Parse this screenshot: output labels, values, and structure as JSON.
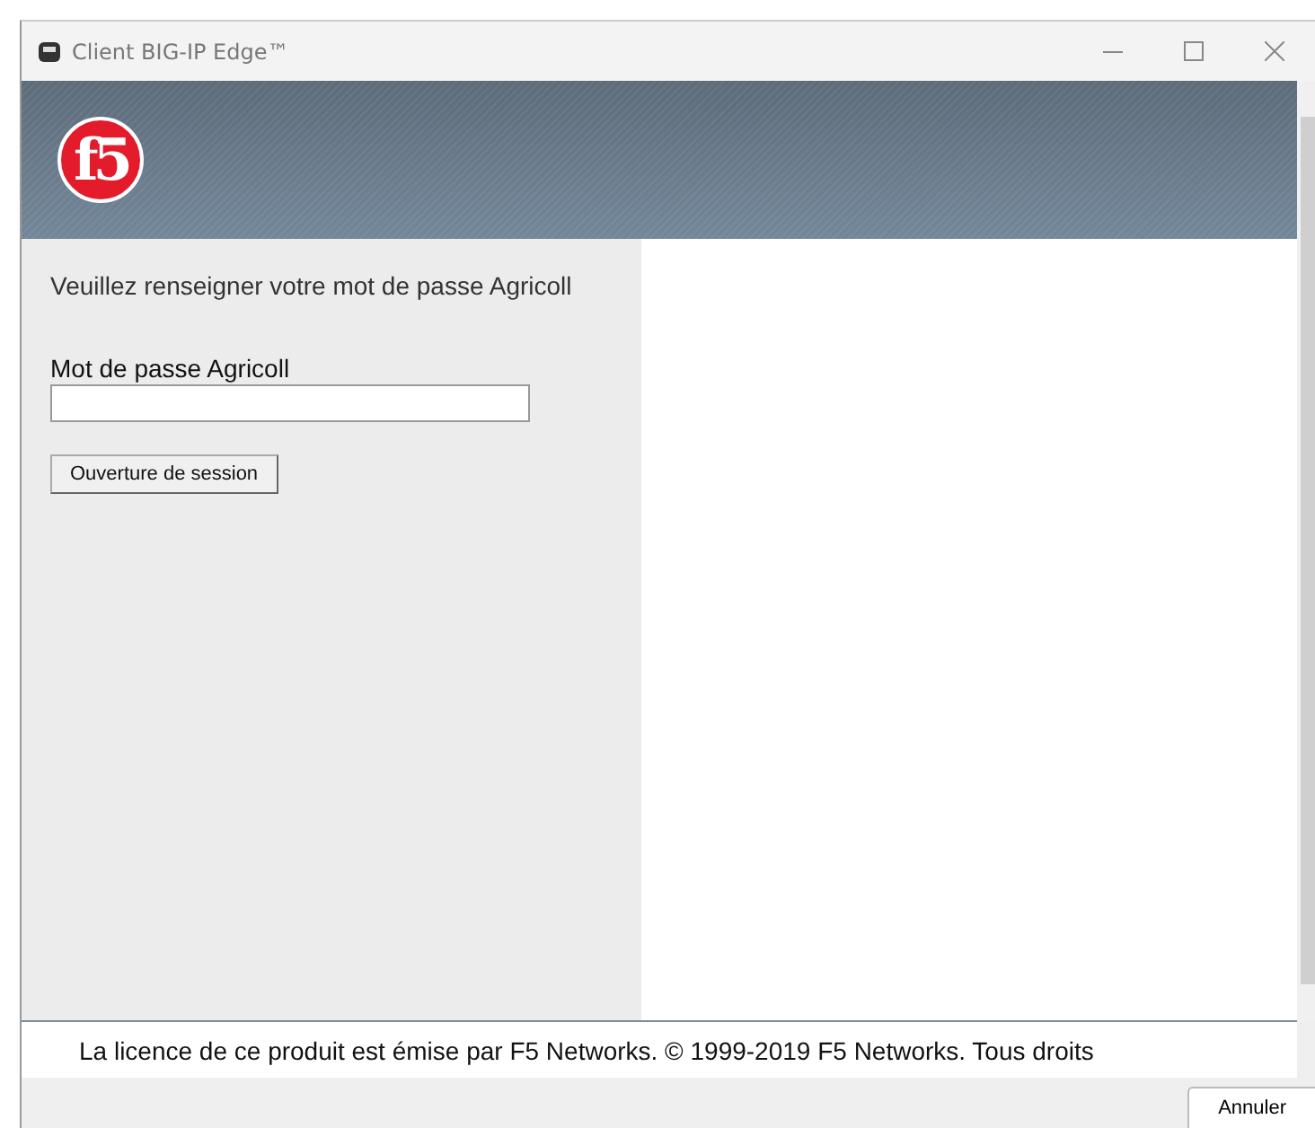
{
  "window": {
    "title": "Client BIG-IP Edge™"
  },
  "banner": {
    "logo_text": "f5"
  },
  "form": {
    "prompt": "Veuillez renseigner votre mot de passe Agricoll",
    "field_label": "Mot de passe Agricoll",
    "submit": "Ouverture de session"
  },
  "footer": {
    "license": "La licence de ce produit est émise par F5 Networks. © 1999-2019 F5 Networks. Tous droits"
  },
  "buttons": [
    "Annuler"
  ]
}
